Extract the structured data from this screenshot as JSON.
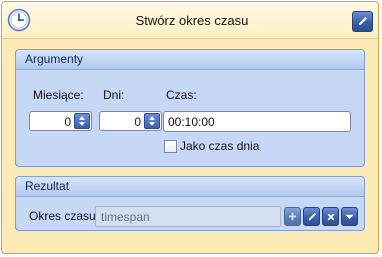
{
  "header": {
    "title": "Stwórz okres czasu",
    "icons": {
      "app": "clock-icon",
      "edit": "pencil-icon"
    }
  },
  "arguments": {
    "title": "Argumenty",
    "months": {
      "label": "Miesiące:",
      "value": "0"
    },
    "days": {
      "label": "Dni:",
      "value": "0"
    },
    "time": {
      "label": "Czas:",
      "value": "00:10:00"
    },
    "time_of_day": {
      "label": "Jako czas dnia",
      "checked": false
    }
  },
  "result": {
    "title": "Rezultat",
    "label": "Okres czasu:",
    "placeholder": "timespan",
    "icons": [
      "plus-icon",
      "pencil-icon",
      "close-icon",
      "chevron-down-icon"
    ]
  },
  "colors": {
    "accent": "#3a60a8",
    "window_bg": "#fdeab7",
    "group_bg": "#c7d8f6"
  }
}
